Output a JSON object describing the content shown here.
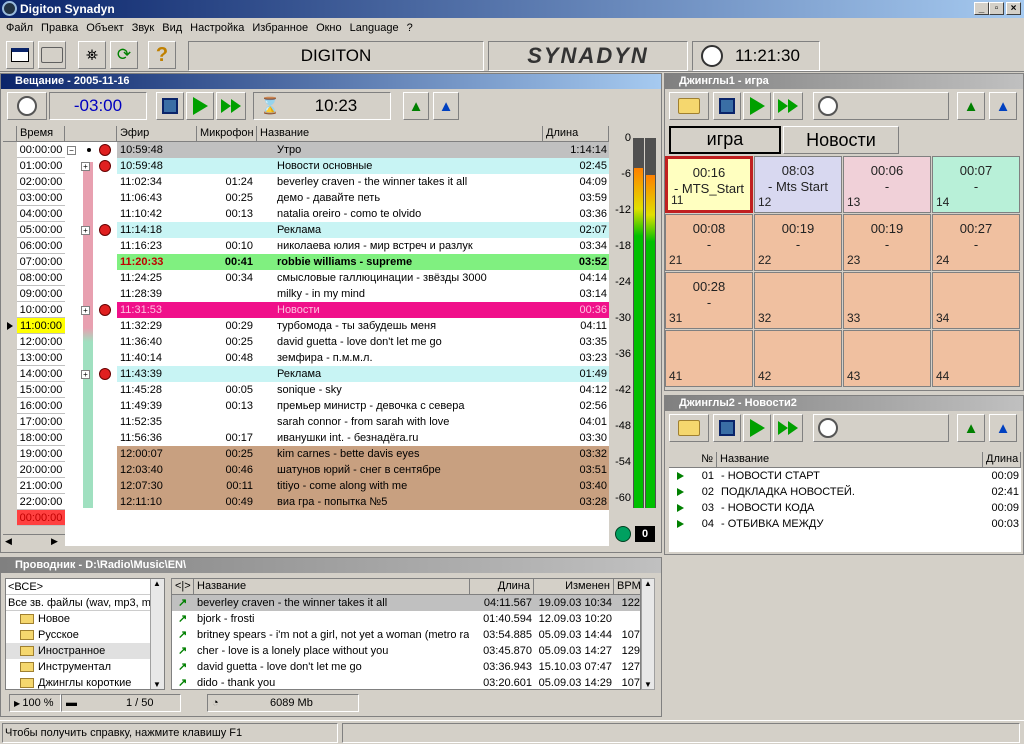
{
  "app": {
    "title": "Digiton Synadyn"
  },
  "menu": [
    "Файл",
    "Правка",
    "Объект",
    "Звук",
    "Вид",
    "Настройка",
    "Избранное",
    "Окно",
    "Language",
    "?"
  ],
  "toolbar": {
    "brand_left": "DIGITON",
    "brand_right": "SYNADYN",
    "clock": "11:21:30"
  },
  "broadcast": {
    "title": "Вещание - 2005-11-16",
    "offset": "-03:00",
    "timer": "10:23",
    "columns": {
      "time": "Время",
      "air": "Эфир",
      "mic": "Микрофон",
      "name": "Название",
      "length": "Длина"
    },
    "hours": [
      "00:00:00",
      "01:00:00",
      "02:00:00",
      "03:00:00",
      "04:00:00",
      "05:00:00",
      "06:00:00",
      "07:00:00",
      "08:00:00",
      "09:00:00",
      "10:00:00",
      "11:00:00",
      "12:00:00",
      "13:00:00",
      "14:00:00",
      "15:00:00",
      "16:00:00",
      "17:00:00",
      "18:00:00",
      "19:00:00",
      "20:00:00",
      "21:00:00",
      "22:00:00",
      "00:00:00"
    ],
    "rows": [
      {
        "air": "10:59:48",
        "mic": "",
        "name": "Утро",
        "len": "1:14:14",
        "bg": "#c0c0c0",
        "fg": "#000"
      },
      {
        "air": "10:59:48",
        "mic": "",
        "name": "Новости основные",
        "len": "02:45",
        "bg": "#c8f4f4",
        "fg": "#000"
      },
      {
        "air": "11:02:34",
        "mic": "01:24",
        "name": "beverley craven - the winner takes it all",
        "len": "04:09",
        "bg": "#ffffff",
        "fg": "#000"
      },
      {
        "air": "11:06:43",
        "mic": "00:25",
        "name": "демо - давайте петь",
        "len": "03:59",
        "bg": "#ffffff",
        "fg": "#000"
      },
      {
        "air": "11:10:42",
        "mic": "00:13",
        "name": "natalia oreiro - como te olvido",
        "len": "03:36",
        "bg": "#ffffff",
        "fg": "#000"
      },
      {
        "air": "11:14:18",
        "mic": "",
        "name": "Реклама",
        "len": "02:07",
        "bg": "#c8f4f4",
        "fg": "#000"
      },
      {
        "air": "11:16:23",
        "mic": "00:10",
        "name": "николаева юлия - мир встреч и разлук",
        "len": "03:34",
        "bg": "#ffffff",
        "fg": "#000"
      },
      {
        "air": "11:20:33",
        "mic": "00:41",
        "name": "robbie williams - supreme",
        "len": "03:52",
        "bg": "#80f080",
        "fg": "#000",
        "bold": true,
        "airfg": "#c00000"
      },
      {
        "air": "11:24:25",
        "mic": "00:34",
        "name": "смысловые галлюцинации - звёзды 3000",
        "len": "04:14",
        "bg": "#ffffff",
        "fg": "#000"
      },
      {
        "air": "11:28:39",
        "mic": "",
        "name": "milky - in my mind",
        "len": "03:14",
        "bg": "#ffffff",
        "fg": "#000"
      },
      {
        "air": "11:31:53",
        "mic": "",
        "name": "Новости",
        "len": "00:36",
        "bg": "#f0108a",
        "fg": "#ffc0e0"
      },
      {
        "air": "11:32:29",
        "mic": "00:29",
        "name": "турбомода - ты забудешь меня",
        "len": "04:11",
        "bg": "#ffffff",
        "fg": "#000"
      },
      {
        "air": "11:36:40",
        "mic": "00:25",
        "name": "david guetta - love don't let me go",
        "len": "03:35",
        "bg": "#ffffff",
        "fg": "#000"
      },
      {
        "air": "11:40:14",
        "mic": "00:48",
        "name": "земфира - п.м.м.л.",
        "len": "03:23",
        "bg": "#ffffff",
        "fg": "#000"
      },
      {
        "air": "11:43:39",
        "mic": "",
        "name": "Реклама",
        "len": "01:49",
        "bg": "#c8f4f4",
        "fg": "#000"
      },
      {
        "air": "11:45:28",
        "mic": "00:05",
        "name": "sonique - sky",
        "len": "04:12",
        "bg": "#ffffff",
        "fg": "#000"
      },
      {
        "air": "11:49:39",
        "mic": "00:13",
        "name": "премьер министр - девочка с севера",
        "len": "02:56",
        "bg": "#ffffff",
        "fg": "#000"
      },
      {
        "air": "11:52:35",
        "mic": "",
        "name": "sarah connor - from sarah with love",
        "len": "04:01",
        "bg": "#ffffff",
        "fg": "#000"
      },
      {
        "air": "11:56:36",
        "mic": "00:17",
        "name": "иванушки int. - безнадёга.ru",
        "len": "03:30",
        "bg": "#ffffff",
        "fg": "#000"
      },
      {
        "air": "12:00:07",
        "mic": "00:25",
        "name": "kim carnes - bette davis eyes",
        "len": "03:32",
        "bg": "#c8a080",
        "fg": "#000"
      },
      {
        "air": "12:03:40",
        "mic": "00:46",
        "name": "шатунов юрий - снег в сентябре",
        "len": "03:51",
        "bg": "#c8a080",
        "fg": "#000"
      },
      {
        "air": "12:07:30",
        "mic": "00:11",
        "name": "titiyo - come along with me",
        "len": "03:40",
        "bg": "#c8a080",
        "fg": "#000"
      },
      {
        "air": "12:11:10",
        "mic": "00:49",
        "name": "виа гра - попытка №5",
        "len": "03:28",
        "bg": "#c8a080",
        "fg": "#000"
      }
    ]
  },
  "meter": {
    "scale": [
      "0",
      "-6",
      "-12",
      "-18",
      "-24",
      "-30",
      "-36",
      "-42",
      "-48",
      "-54",
      "-60"
    ],
    "value": "0",
    "level_left": 0.92,
    "level_right": 0.9
  },
  "jingles1": {
    "title": "Джинглы1 - игра",
    "tabs": [
      "игра",
      "Новости"
    ],
    "cells": [
      {
        "t": "00:16",
        "d": "- MTS_Start",
        "n": "11",
        "bg": "#ffffc0"
      },
      {
        "t": "08:03",
        "d": "- Mts Start",
        "n": "12",
        "bg": "#d8d8f0"
      },
      {
        "t": "00:06",
        "d": "-",
        "n": "13",
        "bg": "#f0d0d8"
      },
      {
        "t": "00:07",
        "d": "-",
        "n": "14",
        "bg": "#b8f0d8"
      },
      {
        "t": "00:08",
        "d": "-",
        "n": "21",
        "bg": "#f0c0a0"
      },
      {
        "t": "00:19",
        "d": "-",
        "n": "22",
        "bg": "#f0c0a0"
      },
      {
        "t": "00:19",
        "d": "-",
        "n": "23",
        "bg": "#f0c0a0"
      },
      {
        "t": "00:27",
        "d": "-",
        "n": "24",
        "bg": "#f0c0a0"
      },
      {
        "t": "00:28",
        "d": "-",
        "n": "31",
        "bg": "#f0c0a0"
      },
      {
        "t": "",
        "d": "",
        "n": "32",
        "bg": "#f0c0a0"
      },
      {
        "t": "",
        "d": "",
        "n": "33",
        "bg": "#f0c0a0"
      },
      {
        "t": "",
        "d": "",
        "n": "34",
        "bg": "#f0c0a0"
      },
      {
        "t": "",
        "d": "",
        "n": "41",
        "bg": "#f0c0a0"
      },
      {
        "t": "",
        "d": "",
        "n": "42",
        "bg": "#f0c0a0"
      },
      {
        "t": "",
        "d": "",
        "n": "43",
        "bg": "#f0c0a0"
      },
      {
        "t": "",
        "d": "",
        "n": "44",
        "bg": "#f0c0a0"
      }
    ]
  },
  "jingles2": {
    "title": "Джинглы2 - Новости2",
    "columns": {
      "no": "№",
      "name": "Название",
      "len": "Длина"
    },
    "rows": [
      {
        "no": "01",
        "name": "- НОВОСТИ СТАРТ",
        "len": "00:09"
      },
      {
        "no": "02",
        "name": "ПОДКЛАДКА НОВОСТЕЙ.",
        "len": "02:41"
      },
      {
        "no": "03",
        "name": "- НОВОСТИ КОДА",
        "len": "00:09"
      },
      {
        "no": "04",
        "name": "- ОТБИВКА МЕЖДУ",
        "len": "00:03"
      }
    ]
  },
  "explorer": {
    "title": "Проводник - D:\\Radio\\Music\\EN\\",
    "filter_all": "<ВСЕ>",
    "filter_types": "Все зв. файлы (wav, mp3, m",
    "folders": [
      "Новое",
      "Русское",
      "Иностранное",
      "Инструментал",
      "Джинглы короткие"
    ],
    "columns": {
      "nav": "<|>",
      "name": "Название",
      "len": "Длина",
      "mod": "Изменен",
      "bpm": "BPM"
    },
    "files": [
      {
        "name": "beverley craven - the winner takes it all",
        "len": "04:11.567",
        "mod": "19.09.03 10:34",
        "bpm": "122"
      },
      {
        "name": "bjork - frosti",
        "len": "01:40.594",
        "mod": "12.09.03 10:20",
        "bpm": ""
      },
      {
        "name": "britney spears - i'm not a girl, not yet a woman (metro radio",
        "len": "03:54.885",
        "mod": "05.09.03 14:44",
        "bpm": "107"
      },
      {
        "name": "cher - love is a lonely place without you",
        "len": "03:45.870",
        "mod": "05.09.03 14:27",
        "bpm": "129"
      },
      {
        "name": "david guetta - love don't let me go",
        "len": "03:36.943",
        "mod": "15.10.03 07:47",
        "bpm": "127"
      },
      {
        "name": "dido - thank you",
        "len": "03:20.601",
        "mod": "05.09.03 14:29",
        "bpm": "107"
      }
    ],
    "zoom": "100 %",
    "page": "1 / 50",
    "free": "6089 Mb"
  },
  "status": {
    "text": "Чтобы получить справку, нажмите клавишу F1"
  }
}
